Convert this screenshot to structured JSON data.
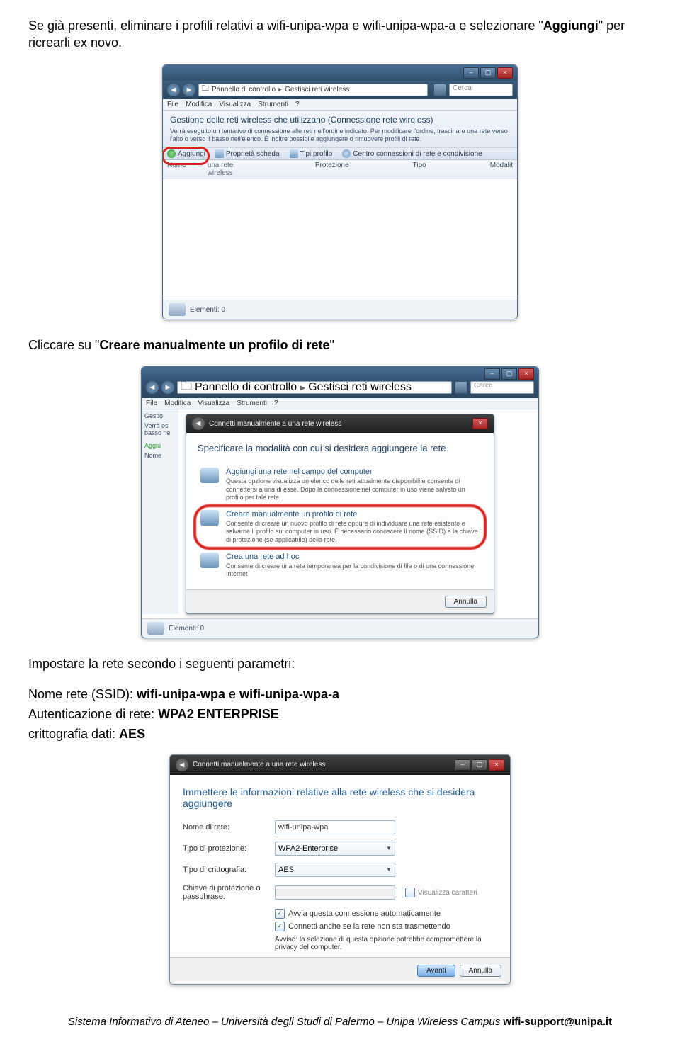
{
  "text": {
    "p1_a": "Se già presenti, eliminare i profili relativi a wifi-unipa-wpa e wifi-unipa-wpa-a e selezionare \"",
    "p1_b": "Aggiungi",
    "p1_c": "\" per ricrearli ex novo.",
    "p2_a": "Cliccare su \"",
    "p2_b": "Creare manualmente un profilo di rete",
    "p2_c": "\"",
    "p3": "Impostare la rete secondo i seguenti parametri:",
    "p4_a": "Nome rete (SSID): ",
    "p4_b": "wifi-unipa-wpa",
    "p4_c": " e ",
    "p4_d": "wifi-unipa-wpa-a",
    "p5_a": "Autenticazione di rete: ",
    "p5_b": "WPA2 ENTERPRISE",
    "p6_a": "crittografia dati: ",
    "p6_b": "AES"
  },
  "shot1": {
    "breadcrumb1": "Pannello di controllo",
    "breadcrumb2": "Gestisci reti wireless",
    "searchPlaceholder": "Cerca",
    "menu": {
      "file": "File",
      "modifica": "Modifica",
      "visualizza": "Visualizza",
      "strumenti": "Strumenti",
      "help": "?"
    },
    "infotitle": "Gestione delle reti wireless che utilizzano (Connessione rete wireless)",
    "infosub": "Verrà eseguito un tentativo di connessione alle reti nell'ordine indicato. Per modificare l'ordine, trascinare una rete verso l'alto o verso il basso nell'elenco. È inoltre possibile aggiungere o rimuovere profili di rete.",
    "tb_add": "Aggiungi",
    "tb_card": "Proprietà scheda",
    "tb_profiles": "Tipi profilo",
    "tb_center": "Centro connessioni di rete e condivisione",
    "col_name": "Nome",
    "col_prot": "Protezione",
    "col_type": "Tipo",
    "col_mod": "Modalit",
    "status": "Elementi: 0",
    "hdrrow2": "una rete wireless"
  },
  "shot2": {
    "title_wiz": "Connetti manualmente a una rete wireless",
    "prompt": "Specificare la modalità con cui si desidera aggiungere la rete",
    "opt1_label": "Aggiungi una rete nel campo del computer",
    "opt1_desc": "Questa opzione visualizza un elenco delle reti attualmente disponibili e consente di connettersi a una di esse. Dopo la connessione nel computer in uso viene salvato un profilo per tale rete.",
    "opt2_label": "Creare manualmente un profilo di rete",
    "opt2_desc": "Consente di creare un nuovo profilo di rete oppure di individuare una rete esistente e salvarne il profilo sul computer in uso. È necessario conoscere il nome (SSID) e la chiave di protezione (se applicabile) della rete.",
    "opt3_label": "Crea una rete ad hoc",
    "opt3_desc": "Consente di creare una rete temporanea per la condivisione di file o di una connessione Internet",
    "cancel": "Annulla",
    "status": "Elementi: 0",
    "side_gestio": "Gestio",
    "side_verra": "Verrà es",
    "side_basso": "basso ne",
    "side_aggiu": "Aggiu",
    "side_nome": "Nome"
  },
  "shot3": {
    "title_wiz": "Connetti manualmente a una rete wireless",
    "heading": "Immettere le informazioni relative alla rete wireless che si desidera aggiungere",
    "lbl_name": "Nome di rete:",
    "val_name": "wifi-unipa-wpa",
    "lbl_sec": "Tipo di protezione:",
    "val_sec": "WPA2-Enterprise",
    "lbl_enc": "Tipo di crittografia:",
    "val_enc": "AES",
    "lbl_key": "Chiave di protezione o passphrase:",
    "chk_show": "Visualizza caratteri",
    "chk_auto": "Avvia questa connessione automaticamente",
    "chk_hidden": "Connetti anche se la rete non sta trasmettendo",
    "warn": "Avviso: la selezione di questa opzione potrebbe compromettere la privacy del computer.",
    "next": "Avanti",
    "cancel": "Annulla"
  },
  "footer": {
    "a": "Sistema Informativo di Ateneo – Università degli Studi di Palermo – Unipa Wireless Campus ",
    "b": "wifi-support@unipa.it"
  }
}
